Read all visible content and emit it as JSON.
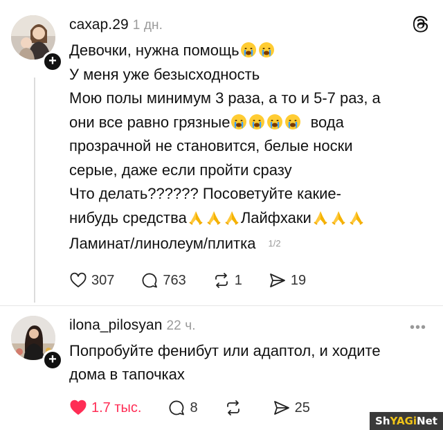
{
  "post": {
    "username": "сахар.29",
    "time": "1 дн.",
    "lines": [
      {
        "text": "Девочки, нужна помощь",
        "emoji": [
          "crying-face",
          "crying-face"
        ]
      },
      {
        "text": "У меня уже безысходность",
        "emoji": []
      },
      {
        "text": "Мою полы минимум 3 раза, а то и 5-7 раз, а",
        "emoji": []
      },
      {
        "text": "они все равно грязные",
        "emoji": [
          "crying-face",
          "crying-face",
          "crying-face",
          "crying-face"
        ],
        "after": "вода"
      },
      {
        "text": "прозрачной не становится, белые носки",
        "emoji": []
      },
      {
        "text": "серые, даже если пройти сразу",
        "emoji": []
      },
      {
        "text": "Что делать?????? Посоветуйте какие-",
        "emoji": []
      },
      {
        "text": "нибудь средства",
        "emoji": [
          "folded-hands",
          "folded-hands",
          "folded-hands"
        ],
        "after": "Лайфхаки",
        "emoji2": [
          "folded-hands",
          "folded-hands",
          "folded-hands"
        ]
      },
      {
        "text": "Ламинат/линолеум/плитка",
        "emoji": []
      }
    ],
    "page_counter": "1/2",
    "actions": {
      "likes": "307",
      "comments": "763",
      "reposts": "1",
      "shares": "19"
    }
  },
  "reply": {
    "username": "ilona_pilosyan",
    "time": "22 ч.",
    "more": "•••",
    "lines": [
      "Попробуйте фенибут или адаптол, и ходите",
      "дома в тапочках"
    ],
    "actions": {
      "likes": "1.7 тыс.",
      "comments": "8",
      "reposts": "",
      "shares": "25"
    }
  },
  "icons": {
    "threads": "threads-logo-icon",
    "heart": "heart-icon",
    "heart_filled": "heart-filled-icon",
    "comment": "comment-icon",
    "repost": "repost-icon",
    "share": "share-icon",
    "plus": "follow-plus-icon"
  },
  "colors": {
    "like_active": "#ff2d55",
    "muted": "#9a9a9a",
    "text": "#111111"
  },
  "watermark": {
    "prefix": "Sh",
    "accent": "YAGi",
    "suffix": "Net"
  }
}
